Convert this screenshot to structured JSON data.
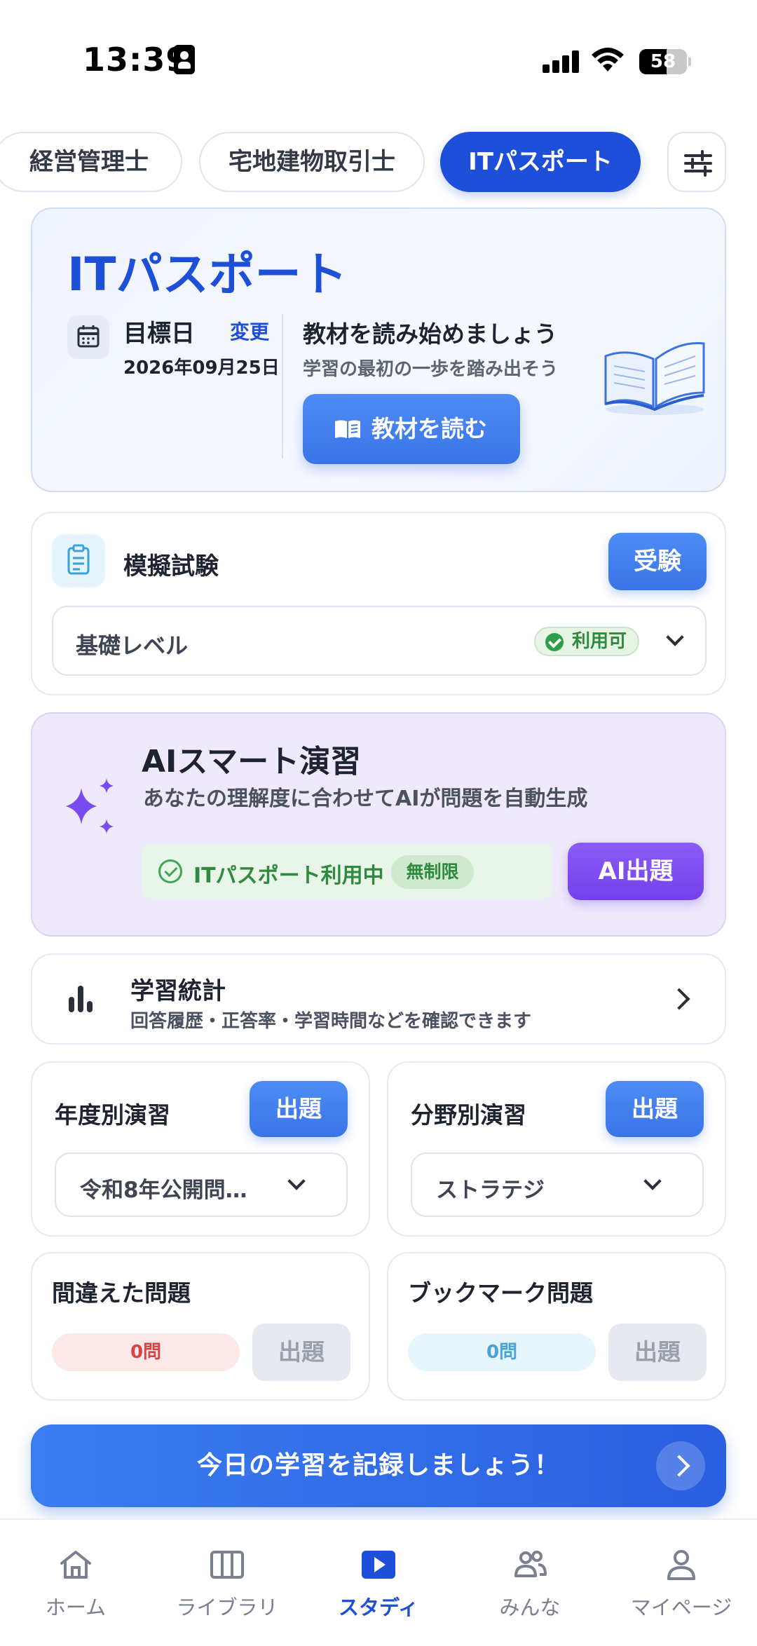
{
  "status_bar": {
    "time": "13:39",
    "battery": "58",
    "battery_level": 0.58
  },
  "chips": {
    "items": [
      {
        "label": "経営管理士",
        "active": false
      },
      {
        "label": "宅地建物取引士",
        "active": false
      },
      {
        "label": "ITパスポート",
        "active": true
      }
    ],
    "filter_icon": "sliders-icon"
  },
  "hero": {
    "title": "ITパスポート",
    "target_label": "目標日",
    "change_label": "変更",
    "target_date": "2026年09月25日",
    "heading": "教材を読み始めましょう",
    "subtitle": "学習の最初の一歩を踏み出そう",
    "read_button": "教材を読む"
  },
  "mock_exam": {
    "title": "模擬試験",
    "button": "受験",
    "level": "基礎レベル",
    "badge": "利用可"
  },
  "ai_practice": {
    "title": "AIスマート演習",
    "subtitle": "あなたの理解度に合わせてAIが問題を自動生成",
    "status": "ITパスポート利用中",
    "unlimited": "無制限",
    "button": "AI出題"
  },
  "stats": {
    "title": "学習統計",
    "subtitle": "回答履歴・正答率・学習時間などを確認できます"
  },
  "year_practice": {
    "title": "年度別演習",
    "button": "出題",
    "selected": "令和8年公開問…"
  },
  "field_practice": {
    "title": "分野別演習",
    "button": "出題",
    "selected": "ストラテジ"
  },
  "wrong_questions": {
    "title": "間違えた問題",
    "count": "0問",
    "button": "出題"
  },
  "bookmark_questions": {
    "title": "ブックマーク問題",
    "count": "0問",
    "button": "出題"
  },
  "cta": {
    "label": "今日の学習を記録しましょう！"
  },
  "tabbar": {
    "items": [
      {
        "label": "ホーム",
        "icon": "home-icon",
        "active": false
      },
      {
        "label": "ライブラリ",
        "icon": "library-icon",
        "active": false
      },
      {
        "label": "スタディ",
        "icon": "play-icon",
        "active": true
      },
      {
        "label": "みんな",
        "icon": "people-icon",
        "active": false
      },
      {
        "label": "マイページ",
        "icon": "person-icon",
        "active": false
      }
    ]
  },
  "colors": {
    "primary": "#1d4fd8",
    "button_blue": "#3a74e8",
    "ai_purple": "#7440ec",
    "success_green": "#2f8a3e",
    "danger_red": "#d64545"
  }
}
